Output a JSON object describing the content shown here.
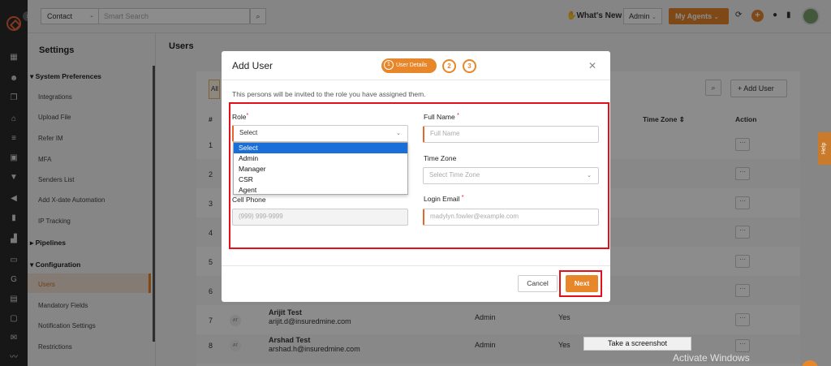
{
  "topbar": {
    "contact_select": "Contact",
    "search_placeholder": "Smart Search",
    "whats_new": "What's New",
    "admin_select": "Admin",
    "my_agents": "My Agents"
  },
  "settings": {
    "title": "Settings",
    "items": [
      {
        "type": "group",
        "label": "System Preferences",
        "expanded": true
      },
      {
        "type": "item",
        "label": "Integrations"
      },
      {
        "type": "item",
        "label": "Upload File"
      },
      {
        "type": "item",
        "label": "Refer IM"
      },
      {
        "type": "item",
        "label": "MFA"
      },
      {
        "type": "item",
        "label": "Senders List"
      },
      {
        "type": "item",
        "label": "Add X-date Automation"
      },
      {
        "type": "item",
        "label": "IP Tracking"
      },
      {
        "type": "group",
        "label": "Pipelines",
        "expanded": false
      },
      {
        "type": "group",
        "label": "Configuration",
        "expanded": true
      },
      {
        "type": "item",
        "label": "Users",
        "active": true
      },
      {
        "type": "item",
        "label": "Mandatory Fields"
      },
      {
        "type": "item",
        "label": "Notification Settings"
      },
      {
        "type": "item",
        "label": "Restrictions"
      }
    ]
  },
  "main": {
    "title": "Users",
    "all_tab": "All",
    "add_user": "Add User",
    "columns": {
      "num": "#",
      "timezone": "Time Zone",
      "action": "Action"
    },
    "rows": [
      {
        "num": "1"
      },
      {
        "num": "2"
      },
      {
        "num": "3"
      },
      {
        "num": "4"
      },
      {
        "num": "5"
      },
      {
        "num": "6"
      },
      {
        "num": "7",
        "initials": "AT",
        "name": "Arijit Test",
        "email": "arijit.d@insuredmine.com",
        "role": "Admin",
        "active": "Yes"
      },
      {
        "num": "8",
        "initials": "AT",
        "name": "Arshad Test",
        "email": "arshad.h@insuredmine.com",
        "role": "Admin",
        "active": "Yes"
      }
    ]
  },
  "help_tab": "Help",
  "modal": {
    "title": "Add User",
    "steps": [
      {
        "num": "1",
        "label": "User Details"
      },
      {
        "num": "2"
      },
      {
        "num": "3"
      }
    ],
    "description": "This persons will be invited to the role you have assigned them.",
    "role_label": "Role",
    "role_value": "Select",
    "role_options": [
      "Select",
      "Admin",
      "Manager",
      "CSR",
      "Agent"
    ],
    "full_name_label": "Full Name",
    "full_name_placeholder": "Full Name",
    "time_zone_label": "Time Zone",
    "time_zone_placeholder": "Select Time Zone",
    "cell_phone_label": "Cell Phone",
    "cell_phone_placeholder": "(999) 999-9999",
    "login_email_label": "Login Email",
    "login_email_placeholder": "madylyn.fowler@example.com",
    "cancel": "Cancel",
    "next": "Next"
  },
  "os": {
    "screenshot_tip": "Take a screenshot",
    "activate_windows": "Activate Windows"
  },
  "colors": {
    "accent": "#e8862a",
    "highlight": "#e3101a",
    "select_blue": "#1a6ed8"
  }
}
